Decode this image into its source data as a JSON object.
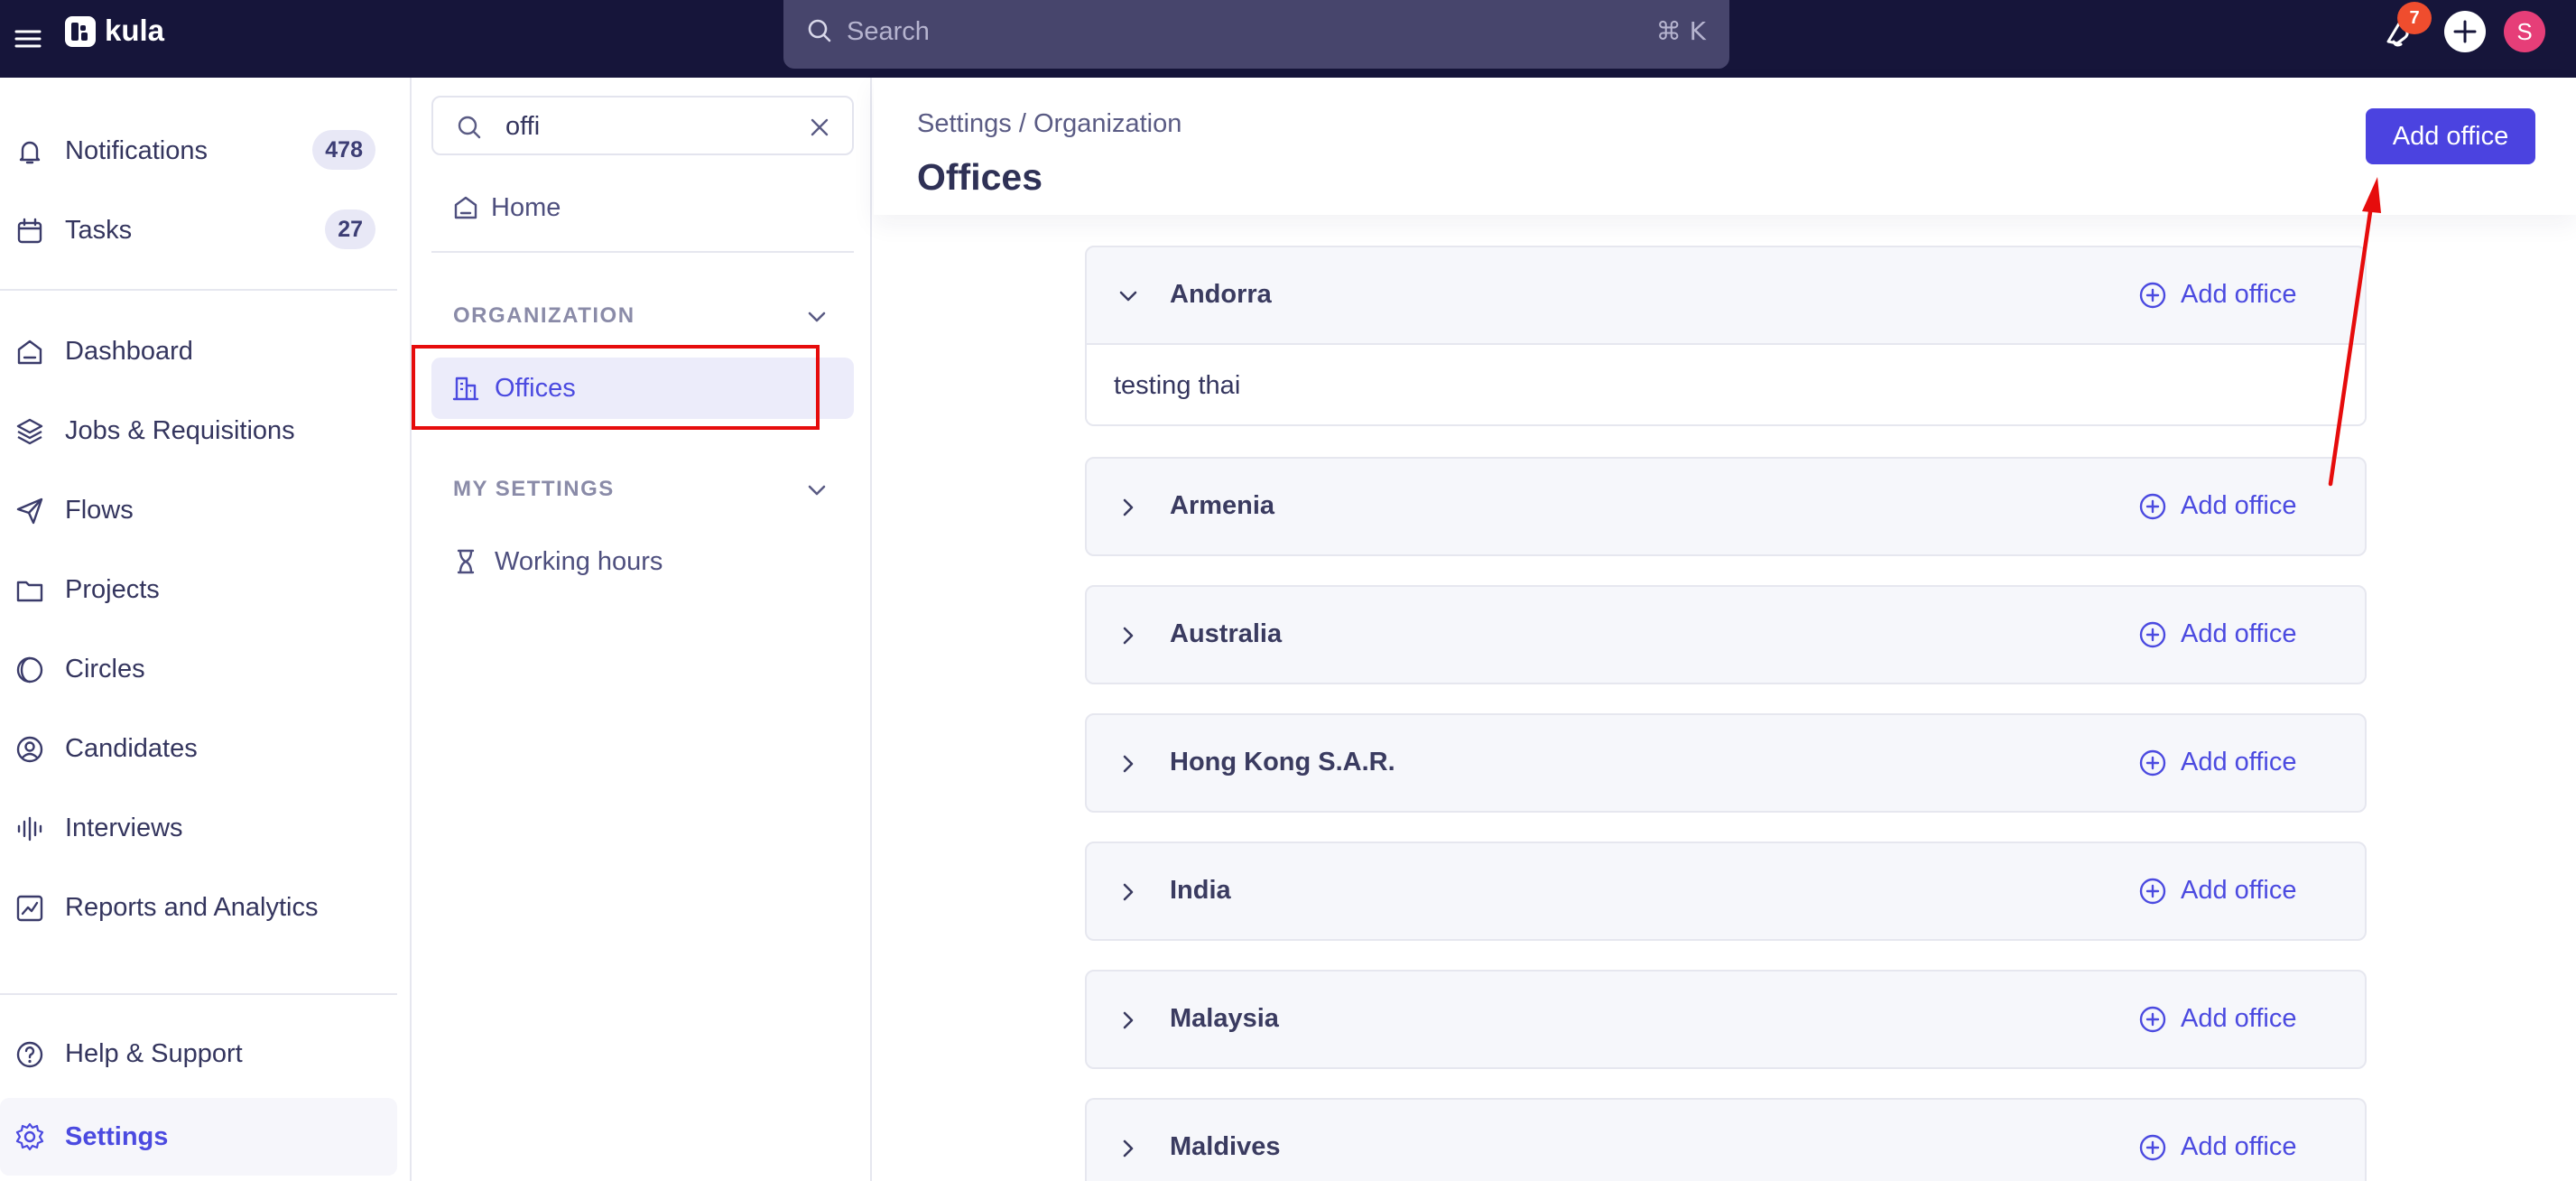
{
  "topbar": {
    "brand": "kula",
    "search_placeholder": "Search",
    "search_shortcut": "⌘ K",
    "notification_badge": "7",
    "avatar_initial": "S"
  },
  "sidebar": {
    "items": [
      {
        "label": "Notifications",
        "badge": "478",
        "icon": "bell-icon"
      },
      {
        "label": "Tasks",
        "badge": "27",
        "icon": "calendar-icon"
      },
      {
        "label": "Dashboard",
        "icon": "home-icon"
      },
      {
        "label": "Jobs & Requisitions",
        "icon": "layers-icon"
      },
      {
        "label": "Flows",
        "icon": "send-icon"
      },
      {
        "label": "Projects",
        "icon": "folder-icon"
      },
      {
        "label": "Circles",
        "icon": "circle-half-icon"
      },
      {
        "label": "Candidates",
        "icon": "user-circle-icon"
      },
      {
        "label": "Interviews",
        "icon": "audio-bars-icon"
      },
      {
        "label": "Reports and Analytics",
        "icon": "chart-icon"
      },
      {
        "label": "Help & Support",
        "icon": "help-icon"
      },
      {
        "label": "Settings",
        "icon": "gear-icon"
      }
    ]
  },
  "settings_nav": {
    "search_value": "offi",
    "home_label": "Home",
    "sections": [
      {
        "title": "ORGANIZATION",
        "links": [
          {
            "label": "Offices"
          }
        ]
      },
      {
        "title": "MY SETTINGS",
        "links": [
          {
            "label": "Working hours"
          }
        ]
      }
    ]
  },
  "main": {
    "breadcrumb": "Settings / Organization",
    "title": "Offices",
    "primary_button": "Add office",
    "countries": [
      {
        "name": "Andorra",
        "expanded": true,
        "add_label": "Add office",
        "offices": [
          "testing thai"
        ]
      },
      {
        "name": "Armenia",
        "expanded": false,
        "add_label": "Add office"
      },
      {
        "name": "Australia",
        "expanded": false,
        "add_label": "Add office"
      },
      {
        "name": "Hong Kong S.A.R.",
        "expanded": false,
        "add_label": "Add office"
      },
      {
        "name": "India",
        "expanded": false,
        "add_label": "Add office"
      },
      {
        "name": "Malaysia",
        "expanded": false,
        "add_label": "Add office"
      },
      {
        "name": "Maldives",
        "expanded": false,
        "add_label": "Add office"
      }
    ]
  },
  "colors": {
    "topbar": "#16153a",
    "accent": "#4b43e0",
    "annotation": "#e60c0c",
    "badge": "#ef4d2e",
    "avatar": "#e63e78"
  }
}
